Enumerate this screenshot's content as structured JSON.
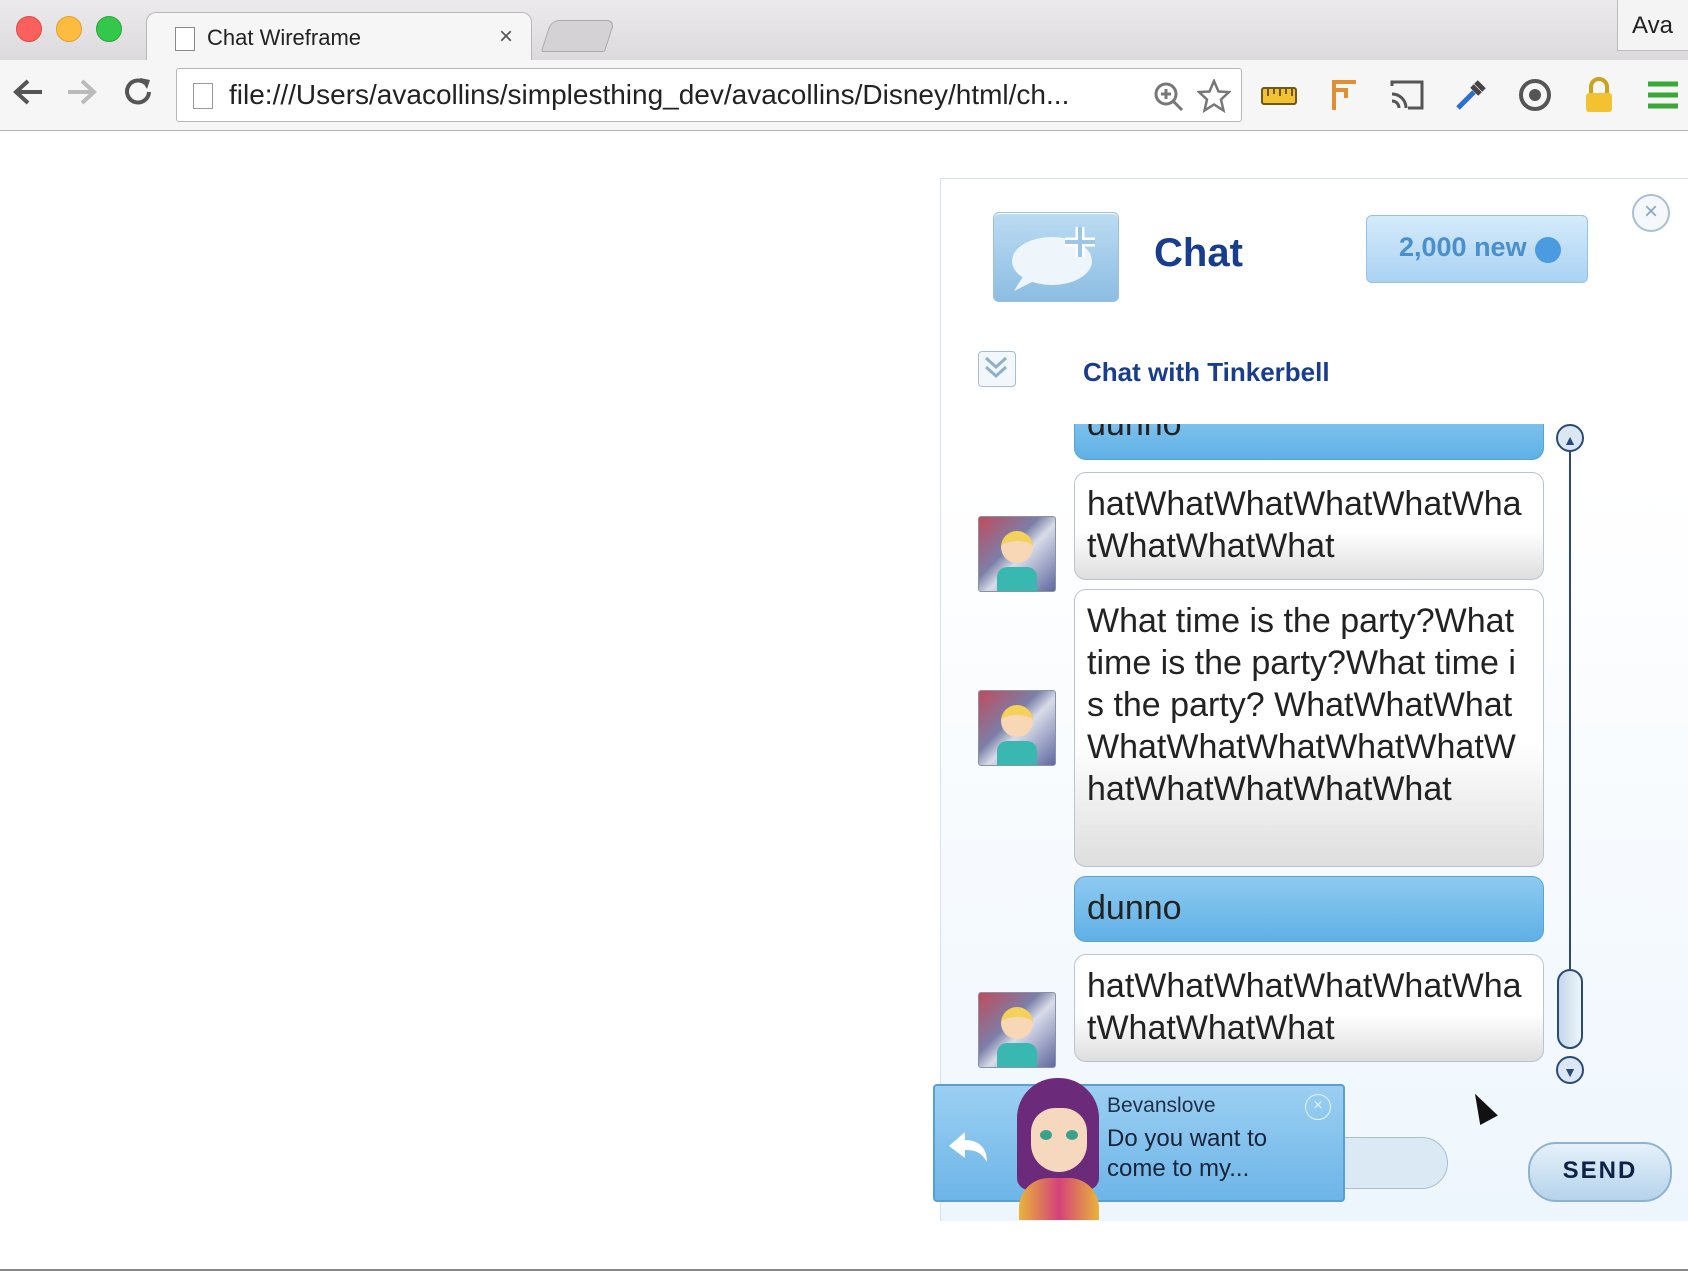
{
  "browser": {
    "tab_title": "Chat Wireframe",
    "tab_close": "×",
    "profile_name": "Ava",
    "url": "file:///Users/avacollins/simplesthing_dev/avacollins/Disney/html/ch..."
  },
  "chat": {
    "title": "Chat",
    "new_badge": "2,000 new",
    "close": "×",
    "conversation_title": "Chat with Tinkerbell",
    "messages": [
      {
        "type": "sent",
        "text": "dunno"
      },
      {
        "type": "received",
        "text": "hatWhatWhatWhatWhatWhatWhatWhatWhat"
      },
      {
        "type": "received",
        "text": "What time is the party?What time is the party?What time is the party? WhatWhatWhatWhatWhatWhatWhatWhatWhatWhatWhatWhatWhat"
      },
      {
        "type": "sent",
        "text": "dunno"
      },
      {
        "type": "received",
        "text": "hatWhatWhatWhatWhatWhatWhatWhatWhat"
      }
    ],
    "send_label": "SEND"
  },
  "notification": {
    "sender": "Bevanslove",
    "message": "Do you want to come to my...",
    "close": "×"
  },
  "colors": {
    "chat_title": "#173d8c",
    "sent_bubble": "#6db5e8",
    "received_bubble": "#ffffff",
    "badge_dot": "#4a9be0"
  },
  "icons": [
    "back-arrow-icon",
    "forward-arrow-icon",
    "reload-icon",
    "page-icon",
    "zoom-icon",
    "star-icon",
    "ruler-icon",
    "crane-icon",
    "cast-icon",
    "eyedropper-icon",
    "sync-icon",
    "lock-icon",
    "menu-icon",
    "new-chat-icon",
    "collapse-icon",
    "reply-icon"
  ]
}
